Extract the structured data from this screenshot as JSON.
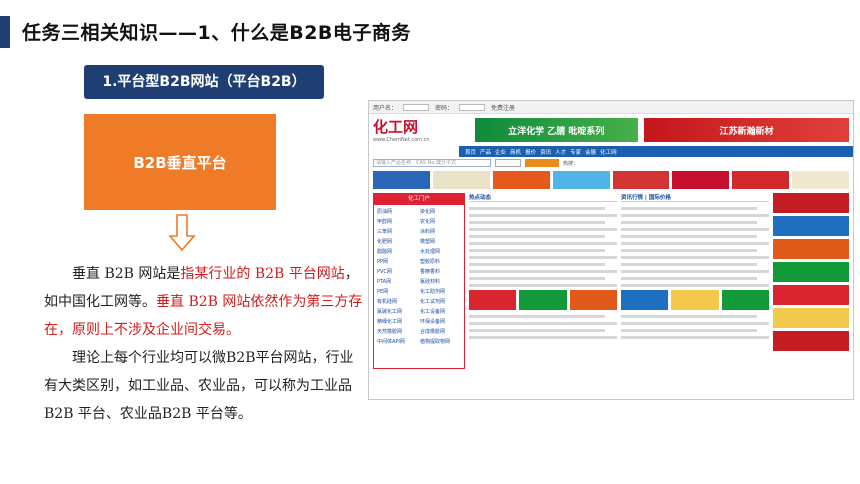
{
  "header": {
    "title": "任务三相关知识——1、什么是B2B电子商务"
  },
  "section": {
    "subheading": "1.平台型B2B网站（平台B2B）",
    "box_label": "B2B垂直平台"
  },
  "body": {
    "p1_a": "垂直 B2B 网站是",
    "p1_red1": "指某行业的 B2B 平台网站",
    "p1_b": "，如中国化工网等。",
    "p1_red2": "垂直 B2B 网站依然作为第三方存在，原则上不涉及企业间交易。",
    "p2": "理论上每个行业均可以微B2B平台网站，行业有大类区别，如工业品、农业品，可以称为工业品 B2B 平台、农业品B2B 平台等。"
  },
  "screenshot": {
    "topbar": {
      "user_label": "用户名：",
      "pass_label": "密码：",
      "register": "免费注册"
    },
    "logo": "化工网",
    "logo_url": "www.ChemNet.com.cn",
    "banner_left": "立洋化学 乙腈 吡啶系列",
    "banner_right": "江苏新瀚新材",
    "nav": [
      "首页",
      "产品",
      "企业",
      "商机",
      "报价",
      "资讯",
      "人才",
      "专家",
      "会展",
      "化工网"
    ],
    "search_placeholder": "请输入产品名称、CAS No.或分子式",
    "hot_label": "热搜：",
    "left_header": "化工门户",
    "left_items": [
      "原油网",
      "染化网",
      "甲醇网",
      "农化网",
      "三苯网",
      "涂料网",
      "化肥网",
      "橡塑网",
      "醋酸网",
      "水处理网",
      "PP网",
      "塑胶原料",
      "PVC网",
      "香精香料",
      "PTA网",
      "氟硅材料",
      "PE网",
      "化工助剂网",
      "有机硅网",
      "化工试剂网",
      "氯碱化工网",
      "化工设备网",
      "精细化工网",
      "环保设备网",
      "天然橡胶网",
      "合成橡胶网",
      "中间体API网",
      "植物提取物网"
    ],
    "mid_header": "热点动态",
    "mid2_header": "资讯行情 | 国际价格"
  }
}
